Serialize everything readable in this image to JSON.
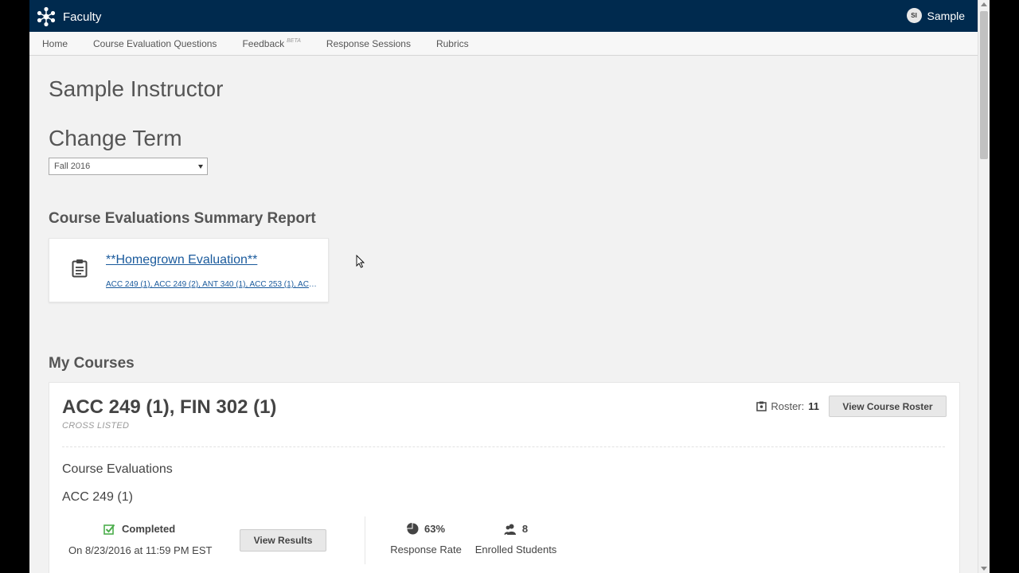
{
  "header": {
    "app_name": "Faculty",
    "user_initials": "SI",
    "user_name": "Sample"
  },
  "nav": {
    "items": [
      {
        "label": "Home"
      },
      {
        "label": "Course Evaluation Questions"
      },
      {
        "label": "Feedback",
        "badge": "BETA"
      },
      {
        "label": "Response Sessions"
      },
      {
        "label": "Rubrics"
      }
    ]
  },
  "page": {
    "title": "Sample Instructor",
    "change_term_heading": "Change Term",
    "term_selected": "Fall 2016",
    "summary_heading": "Course Evaluations Summary Report",
    "summary_card": {
      "eval_title": "**Homegrown Evaluation**",
      "eval_courses": "ACC 249 (1), ACC 249 (2), ANT 340 (1), ACC 253 (1), ACC 141..."
    },
    "my_courses_heading": "My Courses"
  },
  "course": {
    "name": "ACC 249 (1), FIN 302 (1)",
    "tag": "CROSS LISTED",
    "roster_label": "Roster:",
    "roster_count": "11",
    "roster_button": "View Course Roster",
    "evaluations_heading": "Course Evaluations",
    "eval_course": "ACC 249 (1)",
    "status": "Completed",
    "status_date": "On 8/23/2016 at 11:59 PM EST",
    "results_button": "View Results",
    "response_rate_value": "63%",
    "response_rate_label": "Response Rate",
    "enrolled_value": "8",
    "enrolled_label": "Enrolled Students"
  },
  "colors": {
    "header_bg": "#002a4e",
    "link": "#1a5a9c",
    "success": "#4cae4c"
  }
}
